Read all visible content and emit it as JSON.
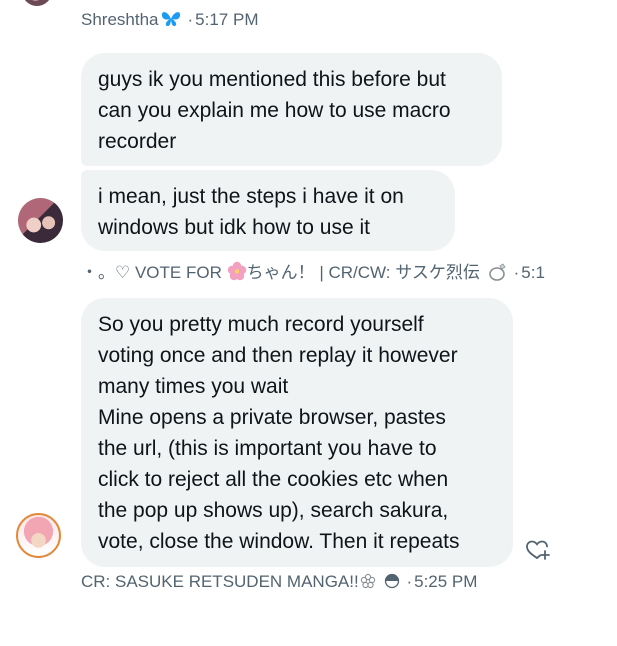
{
  "messages": [
    {
      "sender": "Shreshtha",
      "time": "5:17 PM",
      "bubbles": [
        "guys ik you mentioned this before but\ncan you explain me how to use macro\nrecorder",
        "i mean, just the steps i have it on\nwindows but idk how to use it"
      ]
    },
    {
      "sender_prefix": "・。♡ VOTE FOR",
      "sender_suffix": "ちゃん！ | CR/CW: サスケ烈伝",
      "time": "5:1",
      "bubbles": [
        "So you pretty much record yourself\nvoting once and then replay it however\nmany times you wait\nMine opens a private browser, pastes\nthe url, (this is important you have to\nclick to reject all the cookies etc when\nthe pop up shows up), search sakura,\nvote, close the window. Then it repeats"
      ]
    },
    {
      "sender": "CR: SASUKE RETSUDEN MANGA!!",
      "time": "5:25 PM"
    }
  ],
  "icons": {
    "verified_badge": "butterfly-icon",
    "blossom": "cherry-blossom-icon",
    "ring": "ring-icon",
    "flower_small": "flower-icon",
    "half_circle": "half-circle-icon",
    "reaction": "add-reaction-icon"
  },
  "colors": {
    "bubble": "#eff3f4",
    "meta_text": "#536471",
    "butterfly": "#1d9bf0",
    "blossom": "#f4a0c0"
  }
}
